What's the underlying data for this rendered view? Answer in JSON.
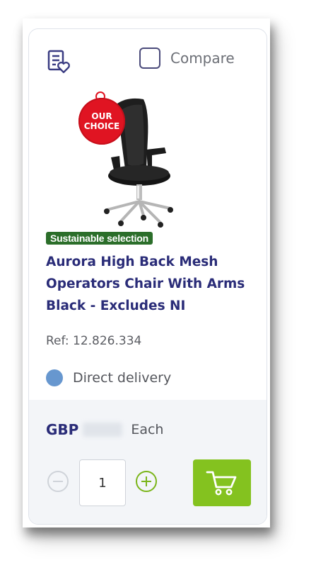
{
  "product": {
    "compare_label": "Compare",
    "badge": [
      "OUR",
      "CHOICE"
    ],
    "sustainable_label": "Sustainable selection",
    "title": "Aurora High Back Mesh Operators Chair With Arms Black - Excludes NI",
    "ref": "Ref: 12.826.334",
    "delivery_label": "Direct delivery"
  },
  "pricing": {
    "currency": "GBP",
    "unit": "Each"
  },
  "quantity": {
    "value": "1"
  },
  "icons": {
    "wishlist": "list-heart-icon",
    "minus": "minus-circle-icon",
    "plus": "plus-circle-icon",
    "cart": "cart-icon"
  },
  "colors": {
    "brand_text": "#2a2c78",
    "sustainable_bg": "#2b6e2a",
    "badge_red": "#e01422",
    "delivery_dot": "#6797cf",
    "cart_green": "#84c21f",
    "plus_green": "#7bb51a"
  }
}
